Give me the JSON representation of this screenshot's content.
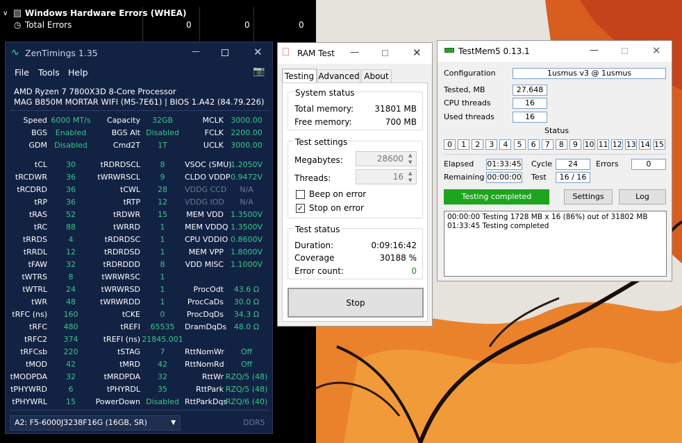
{
  "hwinfo": {
    "section_title": "Windows Hardware Errors (WHEA)",
    "total_label": "Total Errors",
    "values": [
      "0",
      "0",
      "0"
    ]
  },
  "zentimings": {
    "title": "ZenTimings 1.35",
    "menu": [
      "File",
      "Tools",
      "Help"
    ],
    "cpu": "AMD Ryzen 7 7800X3D 8-Core Processor",
    "board": "MAG B850M MORTAR WIFI (MS-7E61) | BIOS 1.A42 (84.79.226)",
    "rows_top": [
      [
        "Speed",
        "6000 MT/s",
        "Capacity",
        "32GB",
        "MCLK",
        "3000.00"
      ],
      [
        "BGS",
        "Enabled",
        "BGS Alt",
        "Disabled",
        "FCLK",
        "2200.00"
      ],
      [
        "GDM",
        "Disabled",
        "Cmd2T",
        "1T",
        "UCLK",
        "3000.00"
      ]
    ],
    "rows": [
      [
        "tCL",
        "30",
        "tRDRDSCL",
        "8",
        "VSOC (SMU)",
        "1.2050V"
      ],
      [
        "tRCDWR",
        "36",
        "tWRWRSCL",
        "9",
        "CLDO VDDP",
        "0.9472V"
      ],
      [
        "tRCDRD",
        "36",
        "tCWL",
        "28",
        "VDDG CCD",
        "N/A"
      ],
      [
        "tRP",
        "36",
        "tRTP",
        "12",
        "VDDG IOD",
        "N/A"
      ],
      [
        "tRAS",
        "52",
        "tRDWR",
        "15",
        "MEM VDD",
        "1.3500V"
      ],
      [
        "tRC",
        "88",
        "tWRRD",
        "1",
        "MEM VDDQ",
        "1.3500V"
      ],
      [
        "tRRDS",
        "4",
        "tRDRDSC",
        "1",
        "CPU VDDIO",
        "0.8600V"
      ],
      [
        "tRRDL",
        "12",
        "tRDRDSD",
        "1",
        "MEM VPP",
        "1.8000V"
      ],
      [
        "tFAW",
        "32",
        "tRDRDDD",
        "8",
        "VDD MISC",
        "1.1000V"
      ],
      [
        "tWTRS",
        "8",
        "tWRWRSC",
        "1",
        "",
        ""
      ],
      [
        "tWTRL",
        "24",
        "tWRWRSD",
        "1",
        "ProcOdt",
        "43.6 Ω"
      ],
      [
        "tWR",
        "48",
        "tWRWRDD",
        "1",
        "ProcCaDs",
        "30.0 Ω"
      ],
      [
        "tRFC (ns)",
        "160",
        "tCKE",
        "0",
        "ProcDqDs",
        "34.3 Ω"
      ],
      [
        "tRFC",
        "480",
        "tREFI",
        "65535",
        "DramDqDs",
        "48.0 Ω"
      ],
      [
        "tRFC2",
        "374",
        "tREFI (ns)",
        "21845.001",
        "",
        ""
      ],
      [
        "tRFCsb",
        "220",
        "tSTAG",
        "7",
        "RttNomWr",
        "Off"
      ],
      [
        "tMOD",
        "42",
        "tMRD",
        "42",
        "RttNomRd",
        "Off"
      ],
      [
        "tMODPDA",
        "32",
        "tMRDPDA",
        "32",
        "RttWr",
        "RZQ/5 (48)"
      ],
      [
        "tPHYWRD",
        "6",
        "tPHYRDL",
        "35",
        "RttPark",
        "RZQ/5 (48)"
      ],
      [
        "tPHYWRL",
        "15",
        "PowerDown",
        "Disabled",
        "RttParkDqs",
        "RZQ/6 (40)"
      ]
    ],
    "dimm_select": "A2: F5-6000J3238F16G (16GB, SR)",
    "ddr": "DDR5"
  },
  "ramtest": {
    "title": "RAM Test",
    "tabs": [
      "Testing",
      "Advanced",
      "About"
    ],
    "system_status": "System status",
    "total_memory_label": "Total memory:",
    "total_memory": "31801 MB",
    "free_memory_label": "Free memory:",
    "free_memory": "700 MB",
    "test_settings": "Test settings",
    "megabytes_label": "Megabytes:",
    "megabytes": "28600",
    "threads_label": "Threads:",
    "threads": "16",
    "beep_label": "Beep on error",
    "stop_label": "Stop on error",
    "test_status": "Test status",
    "duration_label": "Duration:",
    "duration": "0:09:16:42",
    "coverage_label": "Coverage",
    "coverage": "30188 %",
    "error_label": "Error count:",
    "error_count": "0",
    "stop_button": "Stop"
  },
  "testmem": {
    "title": "TestMem5  0.13.1",
    "configuration_label": "Configuration",
    "configuration": "1usmus v3 @ 1usmus",
    "tested_label": "Tested, MB",
    "tested": "27.648",
    "cpu_threads_label": "CPU threads",
    "cpu_threads": "16",
    "used_threads_label": "Used threads",
    "used_threads": "16",
    "status_label": "Status",
    "status_boxes": [
      "0",
      "1",
      "2",
      "3",
      "4",
      "5",
      "6",
      "7",
      "8",
      "9",
      "10",
      "11",
      "12",
      "13",
      "14",
      "15"
    ],
    "elapsed_label": "Elapsed",
    "elapsed": "01:33:45",
    "cycle_label": "Cycle",
    "cycle": "24",
    "errors_label": "Errors",
    "errors": "0",
    "remaining_label": "Remaining",
    "remaining": "00:00:00",
    "test_label": "Test",
    "test": "16 / 16",
    "completed": "Testing completed",
    "settings_button": "Settings",
    "log_button": "Log",
    "log": [
      "00:00:00  Testing 1728 MB x 16 (86%) out of 31802 MB",
      "01:33:45  Testing completed"
    ],
    "accent_green": "#1ea51e"
  }
}
